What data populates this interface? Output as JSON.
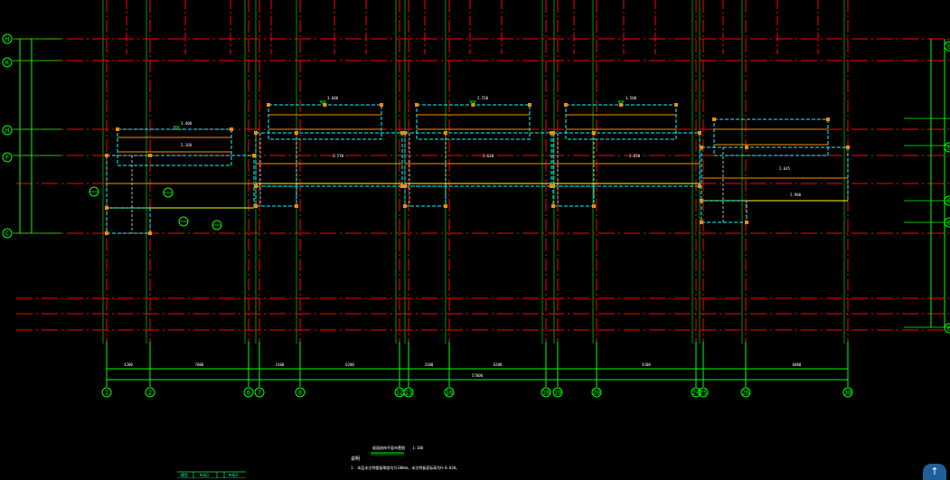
{
  "drawing": {
    "grid_axes_bottom": [
      "1",
      "2",
      "6",
      "7",
      "8",
      "12",
      "13",
      "16",
      "18",
      "19",
      "20",
      "24",
      "25",
      "26",
      "30"
    ],
    "grid_axes_left": [
      "H",
      "K",
      "H",
      "F",
      "C"
    ],
    "grid_axes_right": [
      "E",
      "E",
      "E",
      "E",
      "E"
    ],
    "column_dimensions": [
      "4200",
      "7800",
      "3100",
      "6200",
      "3100",
      "6200",
      "4100",
      "6800"
    ],
    "overall_dimension": "57000",
    "room_area_labels": [
      "2.160",
      "2.570",
      "2.640",
      "2.650",
      "2.645",
      "2.900"
    ],
    "level_marks": [
      "3.400",
      "3.600",
      "2.550",
      "3.500"
    ],
    "title": "屋面结构平面布置图",
    "title_scale": "1:100",
    "notes_heading": "说明",
    "note_1": "1. 本层未注明楼板厚度均为100mm，未注明板面标高为H-0.030。"
  },
  "footer_tab": {
    "labels": [
      "模型",
      "布局1",
      "布局2"
    ]
  },
  "colors": {
    "background": "#000000",
    "axis_line": "#ff0000",
    "grid_green": "#00ff00",
    "beam_yellow": "#ffff00",
    "cyan": "#00ffff",
    "orange": "#ff8c00",
    "white": "#ffffff"
  },
  "nav_button": {
    "icon": "up-arrow-icon",
    "glyph": "↑"
  }
}
